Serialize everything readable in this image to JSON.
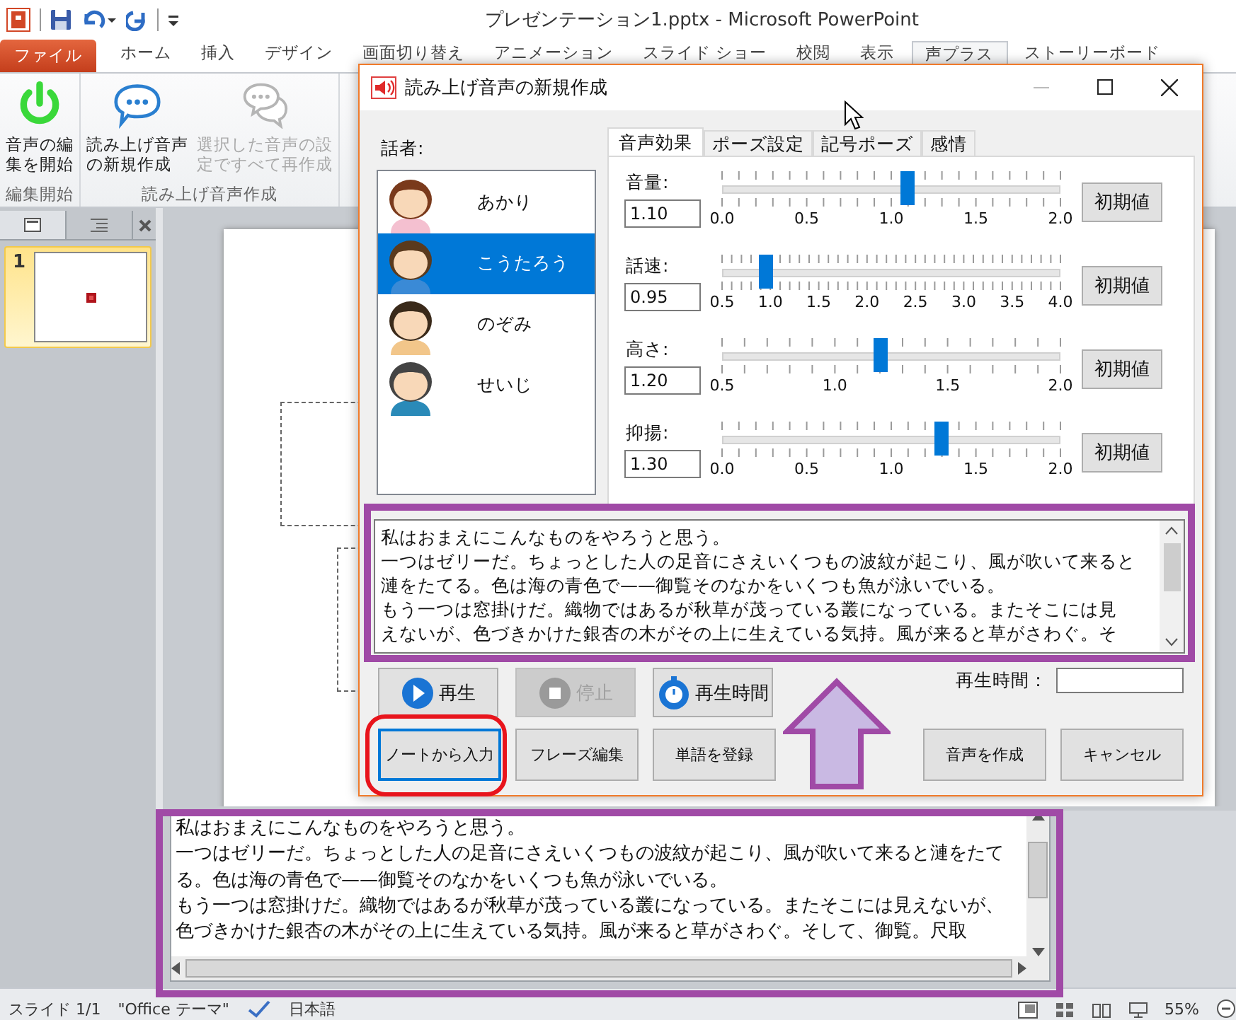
{
  "title_bar": {
    "title": "プレゼンテーション1.pptx - Microsoft PowerPoint"
  },
  "ribbon": {
    "file_tab": {
      "label": "ファイル"
    },
    "tabs": [
      {
        "label": "ホーム",
        "selected": false
      },
      {
        "label": "挿入",
        "selected": false
      },
      {
        "label": "デザイン",
        "selected": false
      },
      {
        "label": "画面切り替え",
        "selected": false
      },
      {
        "label": "アニメーション",
        "selected": false
      },
      {
        "label": "スライド ショー",
        "selected": false
      },
      {
        "label": "校閲",
        "selected": false
      },
      {
        "label": "表示",
        "selected": false
      },
      {
        "label": "声プラス",
        "selected": true
      },
      {
        "label": "ストーリーボード",
        "selected": false
      }
    ],
    "groups": [
      {
        "label": "編集開始",
        "buttons": [
          {
            "lines": [
              "音声の編",
              "集を開始"
            ],
            "kind": "power",
            "disabled": false
          }
        ]
      },
      {
        "label": "読み上げ音声作成",
        "buttons": [
          {
            "lines": [
              "読み上げ音声",
              "の新規作成"
            ],
            "kind": "bubble",
            "disabled": false
          },
          {
            "lines": [
              "選択した音声の設",
              "定ですべて再作成"
            ],
            "kind": "bubbles",
            "disabled": true
          }
        ]
      }
    ]
  },
  "slides_pane": {
    "slides": [
      {
        "number": "1",
        "selected": true
      }
    ]
  },
  "notes": {
    "lines": [
      "私はおまえにこんなものをやろうと思う。",
      "一つはゼリーだ。ちょっとした人の足音にさえいくつもの波紋が起こり、風が吹いて来ると漣をたて",
      "る。色は海の青色で——御覧そのなかをいくつも魚が泳いでいる。",
      "もう一つは窓掛けだ。織物ではあるが秋草が茂っている叢になっている。またそこには見えないが、",
      "色づきかけた銀杏の木がその上に生えている気持。風が来ると草がさわぐ。そして、御覧。尺取"
    ]
  },
  "status_bar": {
    "slide": "スライド 1/1",
    "theme": "\"Office テーマ\"",
    "language": "日本語",
    "zoom": "55%"
  },
  "dialog": {
    "title": "読み上げ音声の新規作成",
    "speaker_label": "話者:",
    "speakers": [
      {
        "name": "あかり",
        "selected": false
      },
      {
        "name": "こうたろう",
        "selected": true
      },
      {
        "name": "のぞみ",
        "selected": false
      },
      {
        "name": "せいじ",
        "selected": false
      }
    ],
    "tabs": [
      {
        "label": "音声効果",
        "selected": true
      },
      {
        "label": "ポーズ設定",
        "selected": false
      },
      {
        "label": "記号ポーズ",
        "selected": false
      },
      {
        "label": "感情",
        "selected": false
      }
    ],
    "sliders": [
      {
        "label": "音量:",
        "value": "1.10",
        "level": 0.55,
        "scale": [
          "0.0",
          "0.5",
          "1.0",
          "1.5",
          "2.0"
        ],
        "reset_button": "初期値"
      },
      {
        "label": "話速:",
        "value": "0.95",
        "level": 0.129,
        "scale": [
          "0.5",
          "1.0",
          "1.5",
          "2.0",
          "2.5",
          "3.0",
          "3.5",
          "4.0"
        ],
        "reset_button": "初期値"
      },
      {
        "label": "高さ:",
        "value": "1.20",
        "level": 0.467,
        "scale": [
          "0.5",
          "1.0",
          "1.5",
          "2.0"
        ],
        "reset_button": "初期値"
      },
      {
        "label": "抑揚:",
        "value": "1.30",
        "level": 0.65,
        "scale": [
          "0.0",
          "0.5",
          "1.0",
          "1.5",
          "2.0"
        ],
        "reset_button": "初期値"
      }
    ],
    "text_lines": [
      "私はおまえにこんなものをやろうと思う。",
      "一つはゼリーだ。ちょっとした人の足音にさえいくつもの波紋が起こり、風が吹いて来ると",
      "漣をたてる。色は海の青色で——御覧そのなかをいくつも魚が泳いでいる。",
      "もう一つは窓掛けだ。織物ではあるが秋草が茂っている叢になっている。またそこには見",
      "えないが、色づきかけた銀杏の木がその上に生えている気持。風が来ると草がさわぐ。そ"
    ],
    "playback_buttons": [
      {
        "label": "再生",
        "kind": "play",
        "disabled": false
      },
      {
        "label": "停止",
        "kind": "stop",
        "disabled": true
      },
      {
        "label": "再生時間",
        "kind": "stopwatch",
        "disabled": false
      }
    ],
    "duration_label": "再生時間：",
    "left_buttons": [
      {
        "label": "ノートから入力",
        "focused": true
      },
      {
        "label": "フレーズ編集",
        "focused": false
      },
      {
        "label": "単語を登録",
        "focused": false
      }
    ],
    "right_buttons": [
      {
        "label": "音声を作成",
        "focused": false
      },
      {
        "label": "キャンセル",
        "focused": false
      }
    ]
  }
}
